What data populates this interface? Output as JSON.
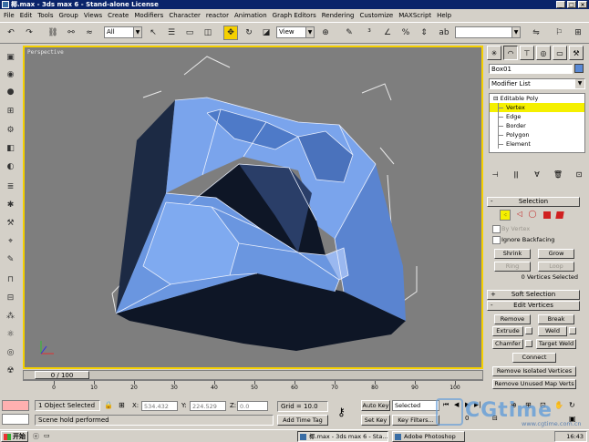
{
  "window": {
    "title": "椰.max - 3ds max 6 - Stand-alone License"
  },
  "menu": [
    "File",
    "Edit",
    "Tools",
    "Group",
    "Views",
    "Create",
    "Modifiers",
    "Character",
    "reactor",
    "Animation",
    "Graph Editors",
    "Rendering",
    "Customize",
    "MAXScript",
    "Help"
  ],
  "toolbar": {
    "selection_filter": "All",
    "ref_coord": "View"
  },
  "viewport": {
    "label": "Perspective"
  },
  "command_panel": {
    "object_name": "Box01",
    "modifier_list": "Modifier List",
    "stack": {
      "base": "Editable Poly",
      "items": [
        "Vertex",
        "Edge",
        "Border",
        "Polygon",
        "Element"
      ],
      "selected": "Vertex"
    },
    "selection": {
      "title": "Selection",
      "by_vertex": "By Vertex",
      "ignore_backfacing": "Ignore Backfacing",
      "shrink": "Shrink",
      "grow": "Grow",
      "ring": "Ring",
      "loop": "Loop",
      "status": "0 Vertices Selected"
    },
    "soft_selection": {
      "title": "Soft Selection"
    },
    "edit_vertices": {
      "title": "Edit Vertices",
      "remove": "Remove",
      "break": "Break",
      "extrude": "Extrude",
      "weld": "Weld",
      "chamfer": "Chamfer",
      "target_weld": "Target Weld",
      "connect": "Connect",
      "remove_isolated": "Remove Isolated Vertices",
      "remove_unused": "Remove Unused Map Verts"
    }
  },
  "timeline": {
    "frame_display": "0 / 100",
    "ticks": [
      "0",
      "10",
      "20",
      "30",
      "40",
      "50",
      "60",
      "70",
      "80",
      "90",
      "100"
    ]
  },
  "status": {
    "selected": "1 Object Selected",
    "prompt": "Scene hold performed",
    "x_label": "X:",
    "x_value": "534.432",
    "y_label": "Y:",
    "y_value": "224.529",
    "z_label": "Z:",
    "z_value": "0.0",
    "grid": "Grid = 10.0",
    "add_time_tag": "Add Time Tag",
    "auto_key": "Auto Key",
    "set_key": "Set Key",
    "key_mode": "Selected",
    "key_filters": "Key Filters...",
    "frame": "0"
  },
  "taskbar": {
    "start": "开始",
    "tasks": [
      "椰.max - 3ds max 6 - Sta...",
      "Adobe Photoshop"
    ],
    "clock": "16:43"
  },
  "watermark": {
    "brand": "CGtime",
    "url": "www.cgtime.com.cn"
  },
  "colors": {
    "title_bar": "#0a246a",
    "viewport_bg": "#7e7e7e",
    "active_border": "#f5d000",
    "mesh": "#6a96e0",
    "mesh_dark": "#1c2a44",
    "vertex_highlight": "#f5f000"
  }
}
